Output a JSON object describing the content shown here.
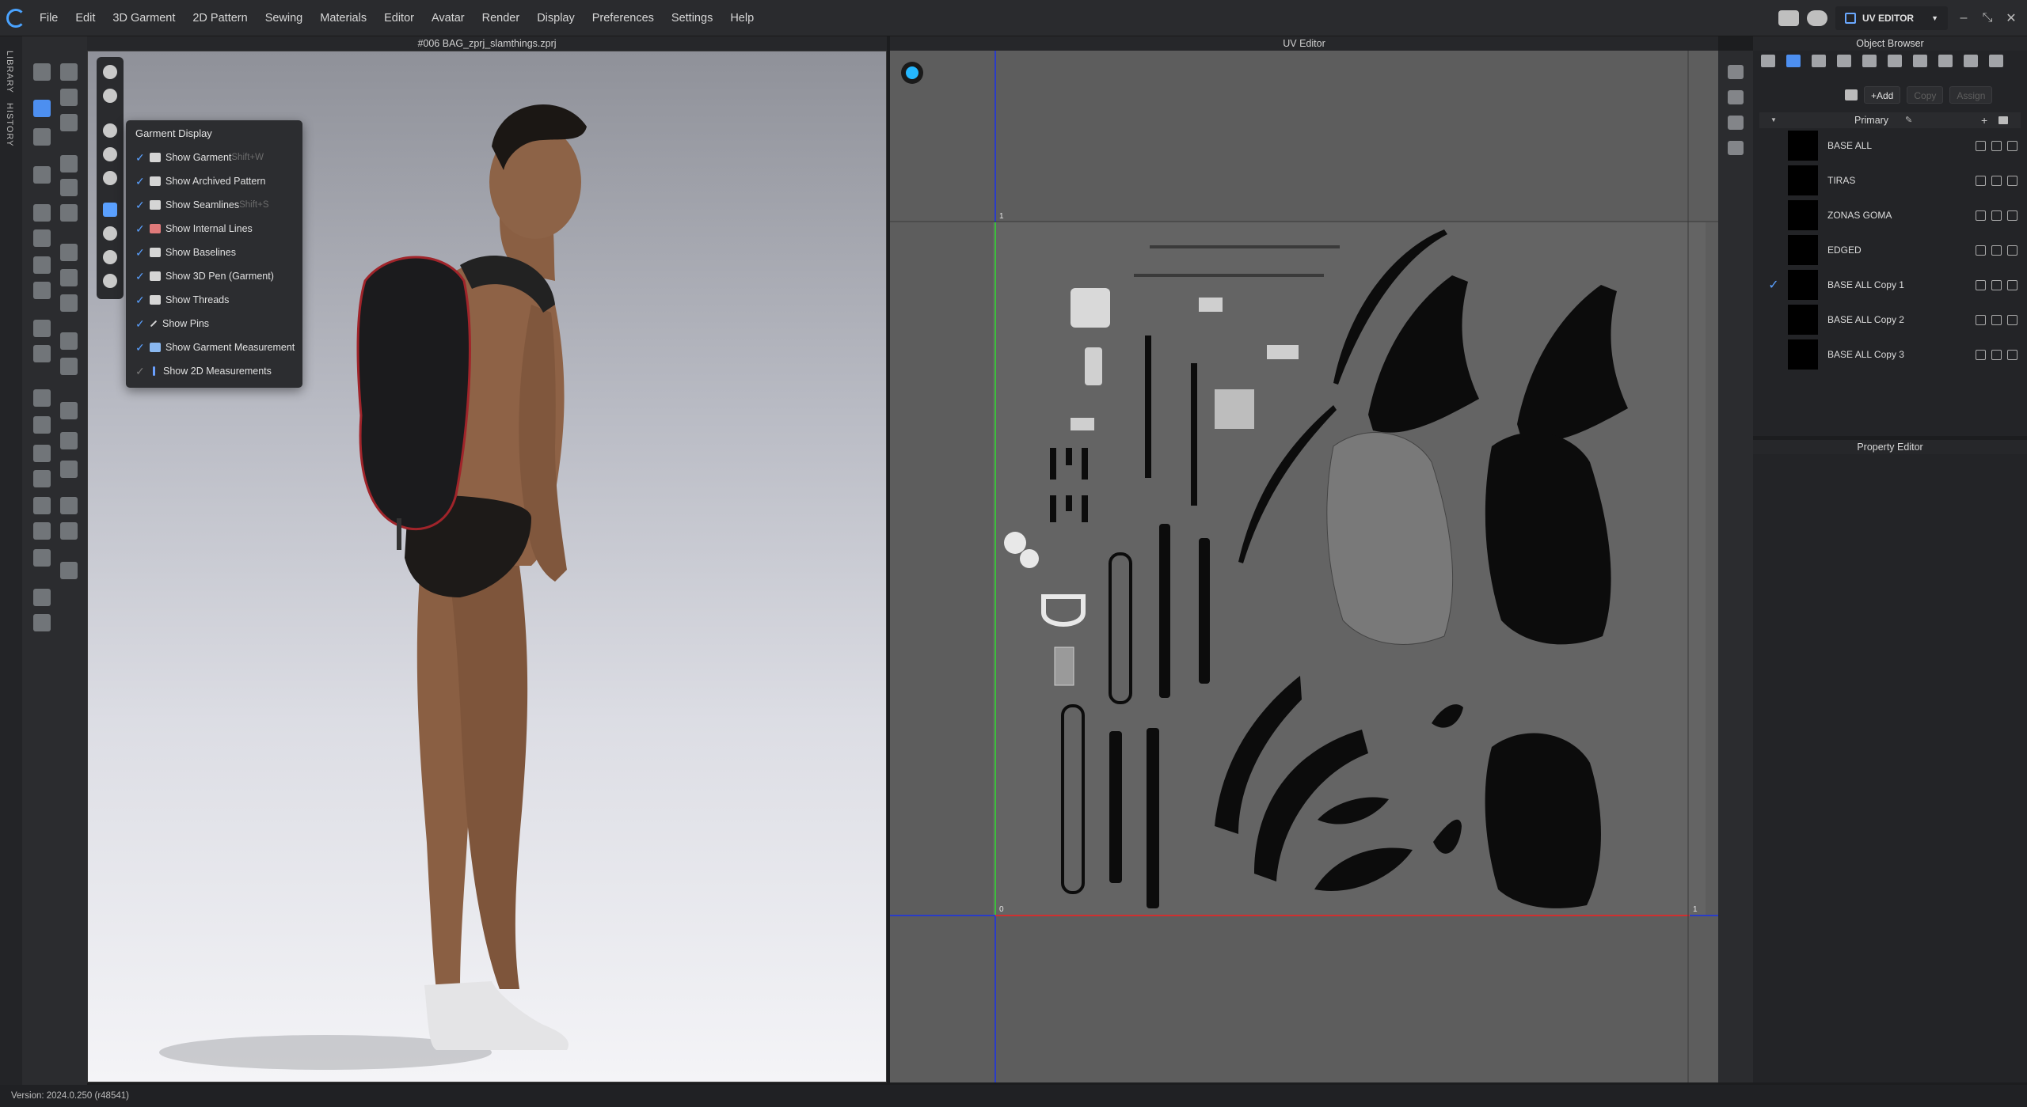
{
  "menubar": {
    "items": [
      "File",
      "Edit",
      "3D Garment",
      "2D Pattern",
      "Sewing",
      "Materials",
      "Editor",
      "Avatar",
      "Render",
      "Display",
      "Preferences",
      "Settings",
      "Help"
    ],
    "mode_label": "UV EDITOR"
  },
  "sidestrip": {
    "library": "LIBRARY",
    "history": "HISTORY"
  },
  "viewport3d": {
    "title": "#006 BAG_zprj_slamthings.zprj"
  },
  "garment_display": {
    "title": "Garment Display",
    "items": [
      {
        "label": "Show Garment",
        "shortcut": "Shift+W",
        "checked": true
      },
      {
        "label": "Show Archived Pattern",
        "shortcut": "",
        "checked": true
      },
      {
        "label": "Show Seamlines",
        "shortcut": "Shift+S",
        "checked": true
      },
      {
        "label": "Show Internal Lines",
        "shortcut": "",
        "checked": true
      },
      {
        "label": "Show Baselines",
        "shortcut": "",
        "checked": true
      },
      {
        "label": "Show 3D Pen (Garment)",
        "shortcut": "",
        "checked": true
      },
      {
        "label": "Show Threads",
        "shortcut": "",
        "checked": true
      },
      {
        "label": "Show Pins",
        "shortcut": "",
        "checked": true
      },
      {
        "label": "Show Garment Measurement",
        "shortcut": "",
        "checked": true
      },
      {
        "label": "Show 2D Measurements",
        "shortcut": "",
        "checked": false
      }
    ]
  },
  "uv_editor": {
    "title": "UV Editor",
    "axis_labels": {
      "top_one": "1",
      "origin": "0",
      "right_one": "1"
    }
  },
  "object_browser": {
    "title": "Object Browser",
    "add_label": "+Add",
    "copy_label": "Copy",
    "assign_label": "Assign",
    "group_label": "Primary",
    "materials": [
      {
        "name": "BASE ALL",
        "selected": false
      },
      {
        "name": "TIRAS",
        "selected": false
      },
      {
        "name": "ZONAS GOMA",
        "selected": false
      },
      {
        "name": "EDGED",
        "selected": false
      },
      {
        "name": "BASE ALL Copy 1",
        "selected": true
      },
      {
        "name": "BASE ALL Copy 2",
        "selected": false
      },
      {
        "name": "BASE ALL Copy 3",
        "selected": false
      }
    ]
  },
  "property_editor": {
    "title": "Property Editor"
  },
  "statusbar": {
    "version": "Version: 2024.0.250 (r48541)"
  },
  "colors": {
    "accent": "#4d8ff0",
    "uv_bg": "#5d5d5d",
    "panel_bg": "#232427"
  }
}
